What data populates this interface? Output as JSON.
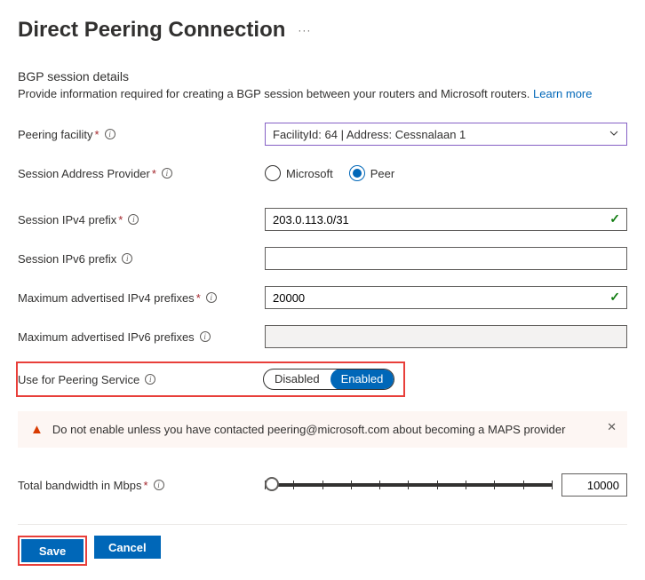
{
  "header": {
    "title": "Direct Peering Connection"
  },
  "section": {
    "title": "BGP session details",
    "subtitle": "Provide information required for creating a BGP session between your routers and Microsoft routers.",
    "learn_more": "Learn more"
  },
  "fields": {
    "facility": {
      "label": "Peering facility",
      "value": "FacilityId: 64 | Address: Cessnalaan 1"
    },
    "sap": {
      "label": "Session Address Provider",
      "options": {
        "microsoft": "Microsoft",
        "peer": "Peer"
      }
    },
    "ipv4_prefix": {
      "label": "Session IPv4 prefix",
      "value": "203.0.113.0/31"
    },
    "ipv6_prefix": {
      "label": "Session IPv6 prefix",
      "value": ""
    },
    "max_ipv4": {
      "label": "Maximum advertised IPv4 prefixes",
      "value": "20000"
    },
    "max_ipv6": {
      "label": "Maximum advertised IPv6 prefixes",
      "value": ""
    },
    "peering_service": {
      "label": "Use for Peering Service",
      "disabled": "Disabled",
      "enabled": "Enabled"
    },
    "bandwidth": {
      "label": "Total bandwidth in Mbps",
      "value": "10000"
    }
  },
  "warning": {
    "text": "Do not enable unless you have contacted peering@microsoft.com about becoming a MAPS provider"
  },
  "buttons": {
    "save": "Save",
    "cancel": "Cancel"
  }
}
